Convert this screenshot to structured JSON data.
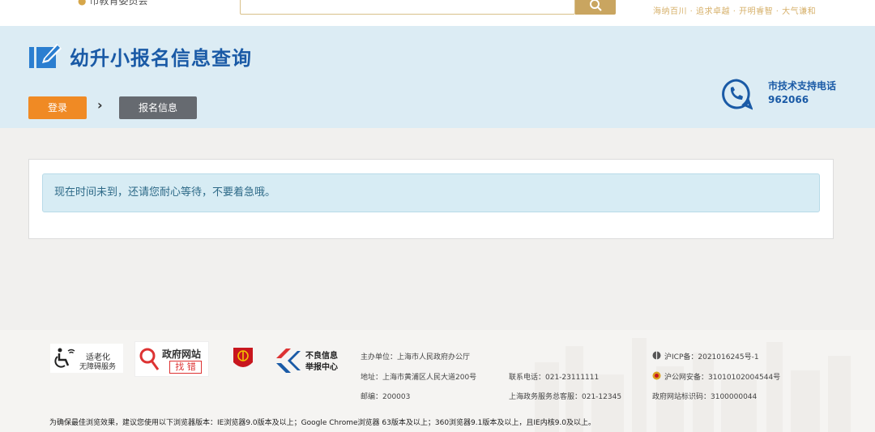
{
  "topbar": {
    "department": "市教育委员会",
    "slogan": "海纳百川 · 追求卓越 · 开明睿智 · 大气谦和"
  },
  "header": {
    "title": "幼升小报名信息查询",
    "steps": [
      "登录",
      "报名信息"
    ],
    "step_separator": "›",
    "support_label": "市技术支持电话",
    "support_number": "962066"
  },
  "main": {
    "notice": "现在时间未到，还请您耐心等待，不要着急哦。"
  },
  "footer": {
    "badges": {
      "age_friendly_line1": "适老化",
      "age_friendly_line2": "无障碍服务",
      "gov_site_line1": "政府网站",
      "gov_site_line2": "找 错",
      "report_line1": "不良信息",
      "report_line2": "举报中心"
    },
    "host": "主办单位：上海市人民政府办公厅",
    "address": "地址：上海市黄浦区人民大道200号",
    "postcode": "邮编：200003",
    "phone": "联系电话：021-23111111",
    "hotline": "上海政务服务总客服：021-12345",
    "icp": "沪ICP备：2021016245号-1",
    "police": "沪公网安备：31010102004544号",
    "site_code": "政府网站标识码：3100000044",
    "browser_note": "为确保最佳浏览效果，建议您使用以下浏览器版本：IE浏览器9.0版本及以上；Google Chrome浏览器 63版本及以上；360浏览器9.1版本及以上，且IE内核9.0及以上。"
  },
  "colors": {
    "accent_blue": "#1a5aa6",
    "login_orange": "#f08a24",
    "step_gray": "#666a70",
    "header_bg": "#dcecf4",
    "notice_bg": "#d7ecf4"
  }
}
